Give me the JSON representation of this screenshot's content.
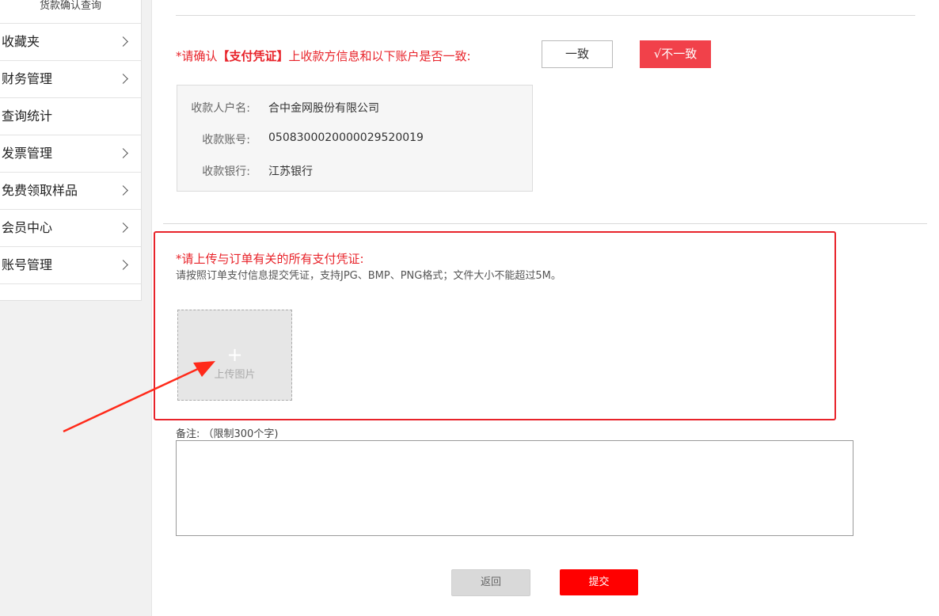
{
  "sidebar": {
    "sub_title": "货款确认查询",
    "items": [
      {
        "label": "收藏夹",
        "has_chevron": true
      },
      {
        "label": "财务管理",
        "has_chevron": true
      },
      {
        "label": "查询统计",
        "has_chevron": false
      },
      {
        "label": "发票管理",
        "has_chevron": true
      },
      {
        "label": "免费领取样品",
        "has_chevron": true
      },
      {
        "label": "会员中心",
        "has_chevron": true
      },
      {
        "label": "账号管理",
        "has_chevron": true
      }
    ]
  },
  "confirm": {
    "prefix": "*请确认",
    "highlight": "【支付凭证】",
    "suffix": "上收款方信息和以下账户是否一致:",
    "consistent_label": "一致",
    "inconsistent_label": "√不一致"
  },
  "account": {
    "name_label": "收款人户名:",
    "name_value": "合中金网股份有限公司",
    "number_label": "收款账号:",
    "number_value": "0508300020000029520019",
    "bank_label": "收款银行:",
    "bank_value": "江苏银行"
  },
  "upload": {
    "title": "*请上传与订单有关的所有支付凭证:",
    "hint": "请按照订单支付信息提交凭证，支持JPG、BMP、PNG格式；文件大小不能超过5M。",
    "plus": "+",
    "button_label": "上传图片"
  },
  "remark": {
    "label": "备注: （限制300个字)"
  },
  "actions": {
    "back_label": "返回",
    "submit_label": "提交"
  },
  "colors": {
    "accent_red": "#e8232a",
    "button_red": "#f1414a",
    "submit_red": "#ff0000"
  }
}
